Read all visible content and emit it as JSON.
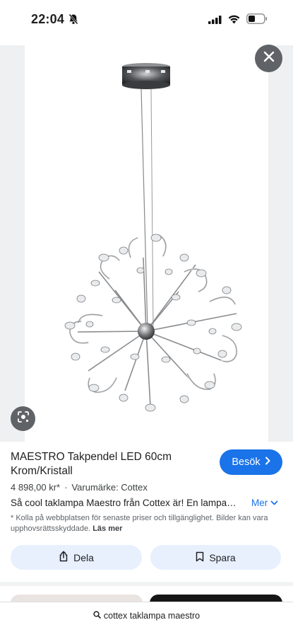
{
  "status_bar": {
    "time": "22:04",
    "icons": [
      "bell-off-icon",
      "signal-icon",
      "wifi-icon",
      "battery-icon"
    ]
  },
  "image_viewer": {
    "close_icon": "close-icon",
    "lens_icon": "lens-icon"
  },
  "product": {
    "title": "MAESTRO Takpendel LED 60cm Krom/Kristall",
    "visit_label": "Besök",
    "price": "4 898,00 kr*",
    "brand": "Varumärke: Cottex",
    "description": "Så cool taklampa Maestro från Cottex är! En lampa…",
    "more_label": "Mer",
    "note": "* Kolla på webbplatsen för senaste priser och tillgänglighet. Bilder kan vara upphovsrättsskyddade.",
    "read_more_label": "Läs mer"
  },
  "actions": {
    "share_label": "Dela",
    "save_label": "Spara"
  },
  "search": {
    "query": "cottex taklampa maestro"
  },
  "colors": {
    "accent": "#1a73e8",
    "chip_bg": "#e8f0fe",
    "overlay_button": "#5f6368"
  }
}
